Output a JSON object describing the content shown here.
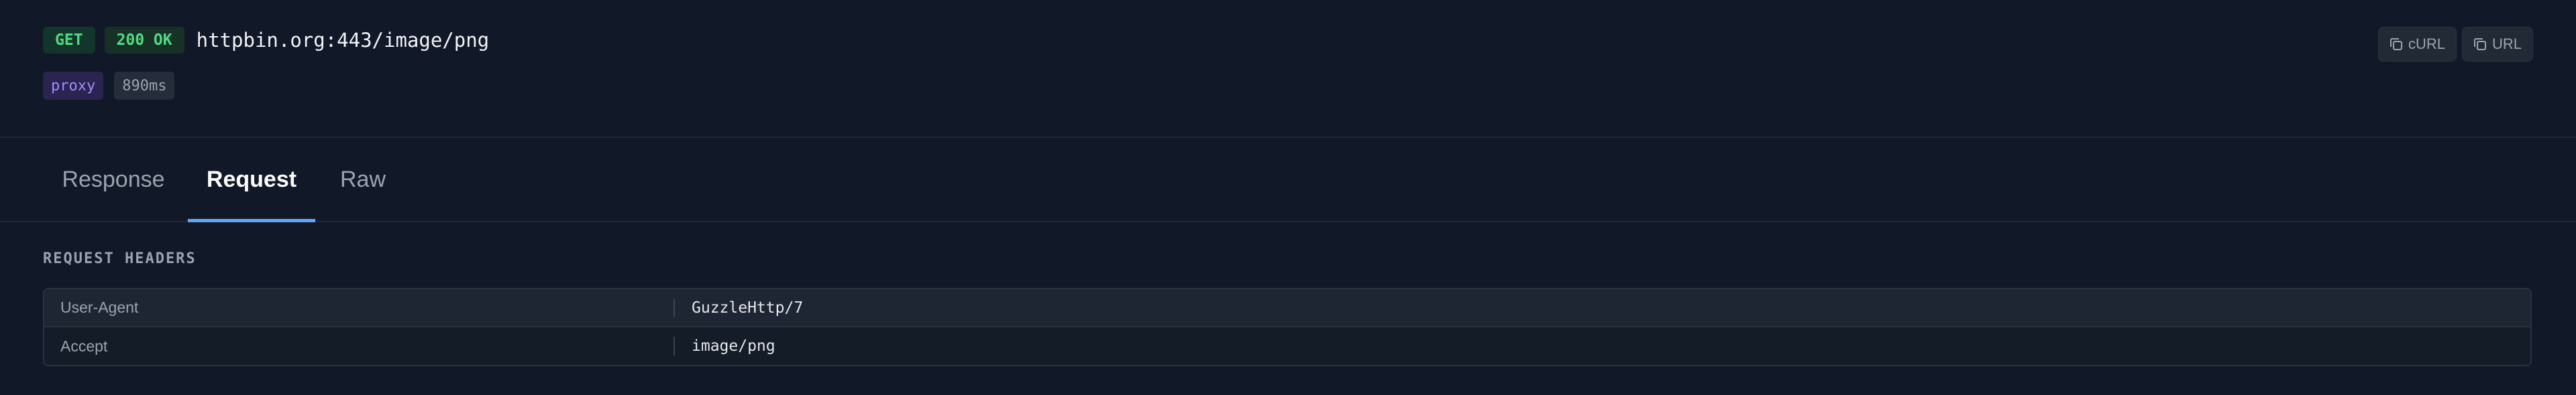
{
  "request": {
    "method": "GET",
    "status": "200 OK",
    "url": "httpbin.org:443/image/png",
    "tag": "proxy",
    "duration": "890ms"
  },
  "actions": {
    "curl_label": "cURL",
    "url_label": "URL",
    "curl_icon": "copy-icon",
    "url_icon": "copy-icon"
  },
  "tabs": [
    {
      "label": "Response",
      "active": false
    },
    {
      "label": "Request",
      "active": true
    },
    {
      "label": "Raw",
      "active": false
    }
  ],
  "request_headers": {
    "title": "REQUEST HEADERS",
    "rows": [
      {
        "name": "User-Agent",
        "value": "GuzzleHttp/7"
      },
      {
        "name": "Accept",
        "value": "image/png"
      }
    ]
  },
  "colors": {
    "background": "#111827",
    "accent": "#60a5fa",
    "success": "#4ade80",
    "proxy_tag": "#a78bfa"
  }
}
